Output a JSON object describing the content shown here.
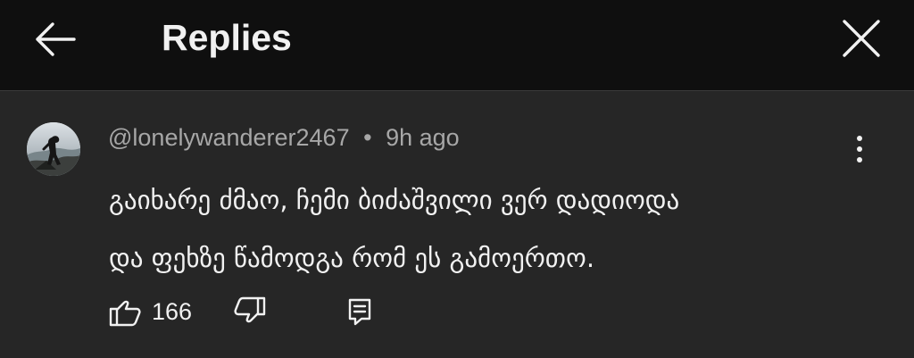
{
  "header": {
    "title": "Replies",
    "back_icon": "arrow-left-icon",
    "close_icon": "close-icon"
  },
  "comment": {
    "avatar": "avatar",
    "username": "@lonelywanderer2467",
    "separator": "•",
    "time": "9h ago",
    "text_lines": [
      "გაიხარე ძმაო, ჩემი ბიძაშვილი ვერ დადიოდა",
      "და ფეხზე წამოდგა რომ ეს გამოერთო."
    ],
    "menu_icon": "more-vertical-icon",
    "actions": {
      "like_icon": "thumb-up-icon",
      "like_count": "166",
      "dislike_icon": "thumb-down-icon",
      "reply_icon": "comment-reply-icon"
    }
  },
  "colors": {
    "header_background": "#0f0f0f",
    "panel_background": "#262626",
    "primary_text": "#f1f1f1",
    "secondary_text": "#a7a7a7",
    "divider": "#3a3a3a"
  }
}
